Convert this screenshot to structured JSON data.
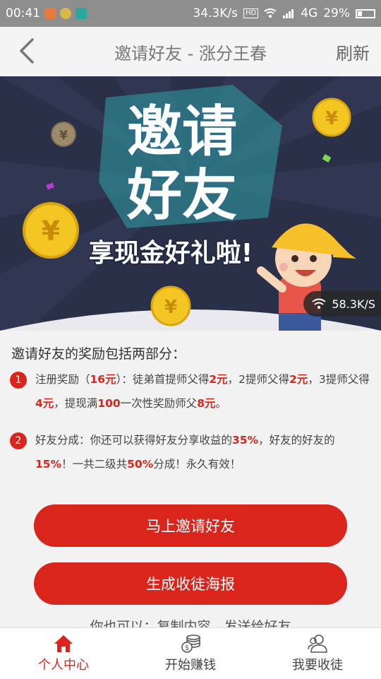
{
  "status_bar": {
    "time": "00:41",
    "net_speed": "34.3K/s",
    "hd_label": "HD",
    "network": "4G",
    "battery": "29%"
  },
  "header": {
    "title": "邀请好友 - 涨分王春",
    "refresh_label": "刷新"
  },
  "banner": {
    "headline_line1": "邀请",
    "headline_line2": "好友",
    "subline": "享现金好礼啦!",
    "speed_badge": "58.3K/S"
  },
  "content": {
    "intro": "邀请好友的奖励包括两部分：",
    "item1": {
      "num": "1",
      "p1": "注册奖励（",
      "b1": "16元",
      "p2": "）：徒弟首提师父得",
      "b2": "2元",
      "p3": "，2提师父得",
      "b3": "2元",
      "p4": "，3提师父得",
      "b4": "4元",
      "p5": "，提现满",
      "b5": "100",
      "p6": "一次性奖励师父",
      "b6": "8元",
      "p7": "。"
    },
    "item2": {
      "num": "2",
      "p1": "好友分成：你还可以获得好友分享收益的",
      "b1": "35%",
      "p2": "，好友的好友的",
      "b2": "15%",
      "p3": "！一共二级共",
      "b3": "50%",
      "p4": "分成！永久有效！"
    },
    "invite_button": "马上邀请好友",
    "poster_button": "生成收徒海报",
    "more_text": "你也可以：复制内容，发送给好友"
  },
  "nav": {
    "items": [
      {
        "label": "个人中心",
        "icon": "home-icon",
        "active": true
      },
      {
        "label": "开始赚钱",
        "icon": "coins-icon",
        "active": false
      },
      {
        "label": "我要收徒",
        "icon": "users-icon",
        "active": false
      }
    ]
  },
  "colors": {
    "accent": "#d9251b",
    "banner_bg": "#2b3049",
    "coin": "#f3c623",
    "status_bar": "#8e8e8e"
  }
}
